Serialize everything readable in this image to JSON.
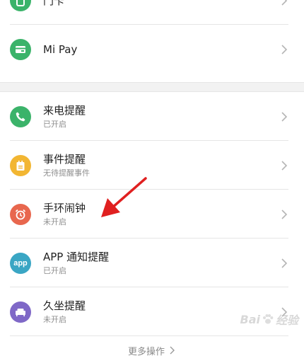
{
  "list_top": [
    {
      "title": "门卡",
      "subtitle": "",
      "icon": "card-icon",
      "color": "#3bb36a"
    },
    {
      "title": "Mi Pay",
      "subtitle": "",
      "icon": "wallet-icon",
      "color": "#3bb36a"
    }
  ],
  "list_alerts": [
    {
      "title": "来电提醒",
      "subtitle": "已开启",
      "icon": "phone-icon",
      "color": "#3bb36a"
    },
    {
      "title": "事件提醒",
      "subtitle": "无待提醒事件",
      "icon": "calendar-icon",
      "color": "#f2b632"
    },
    {
      "title": "手环闹钟",
      "subtitle": "未开启",
      "icon": "alarm-clock-icon",
      "color": "#e8674e"
    },
    {
      "title": "APP 通知提醒",
      "subtitle": "已开启",
      "icon": "app-icon",
      "color": "#3aa6c4",
      "icon_text": "app"
    },
    {
      "title": "久坐提醒",
      "subtitle": "未开启",
      "icon": "sofa-icon",
      "color": "#7f68c7"
    }
  ],
  "more": {
    "label": "更多操作",
    "icon": "chevron-right-icon"
  },
  "watermark": {
    "text_left": "Bai",
    "text_right": "经验",
    "icon": "paw-icon"
  },
  "annotation": {
    "icon": "red-arrow-icon",
    "color": "#e02020"
  }
}
